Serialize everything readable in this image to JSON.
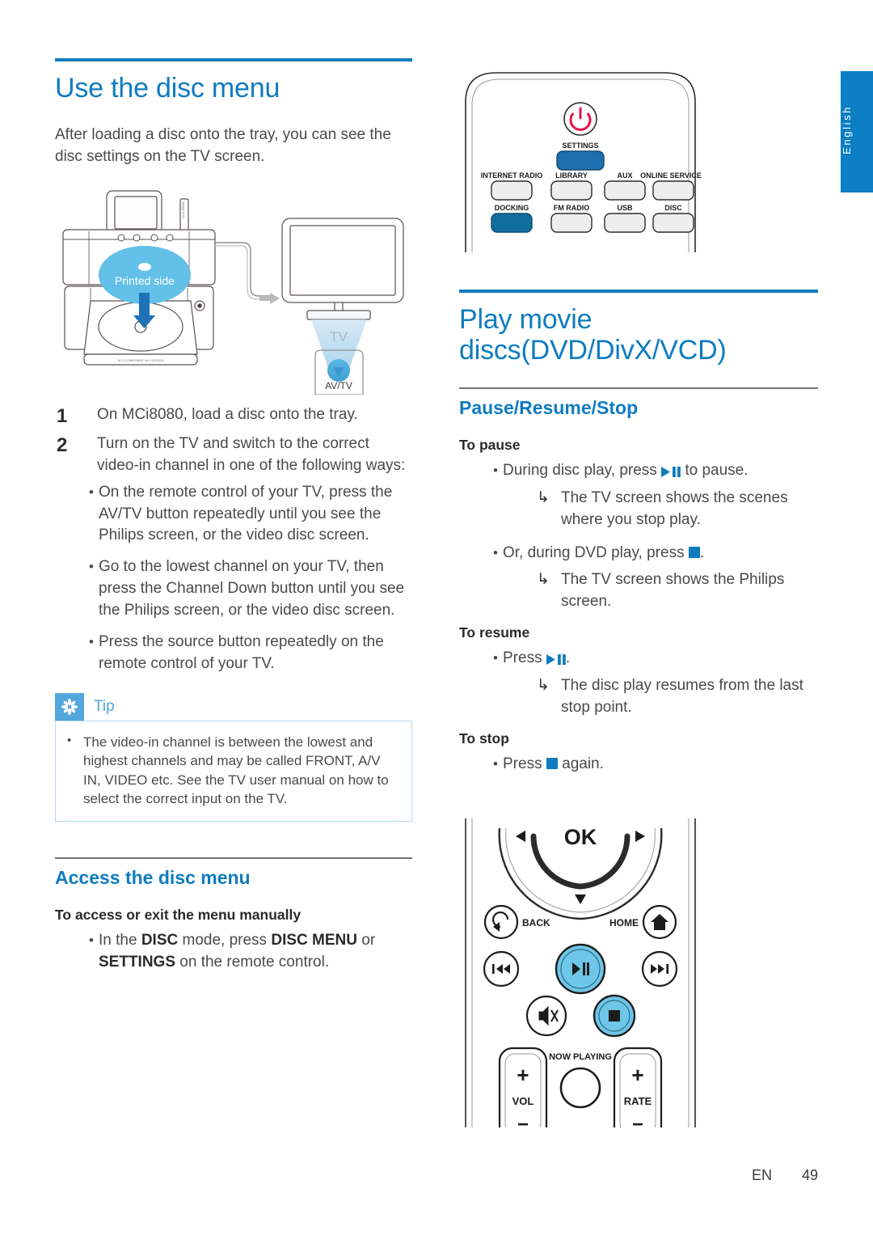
{
  "page": {
    "language_tab": "English",
    "footer_lang": "EN",
    "footer_page": "49"
  },
  "left_column": {
    "title": "Use the disc menu",
    "intro": "After loading a disc onto the tray, you can see the disc settings on the TV screen.",
    "figure_device": {
      "disc_label": "Printed side",
      "tv_label": "TV",
      "avtv_label": "AV/TV",
      "device_badge": "HI-FI COMPONENT Hi-Fi SYSTEM",
      "dock_label": "Up to 500GB"
    },
    "steps": [
      {
        "num": "1",
        "text": "On MCi8080, load a disc onto the tray."
      },
      {
        "num": "2",
        "text": "Turn on the TV and switch to the correct video-in channel in one of the following ways:"
      }
    ],
    "step2_bullets": [
      "On the remote control of your TV, press the AV/TV button repeatedly until you see the Philips screen, or the video disc screen.",
      "Go to the lowest channel on your TV, then press the Channel Down button until you see the Philips screen, or the video disc screen.",
      "Press the source button repeatedly on the remote control of your TV."
    ],
    "tip": {
      "label": "Tip",
      "items": [
        "The video-in channel is between the lowest and highest channels and may be called FRONT, A/V IN, VIDEO etc. See the TV user manual on how to select the correct input on the TV."
      ]
    },
    "access_section": {
      "title": "Access the disc menu",
      "subheading": "To access or exit the menu manually",
      "bullet_parts": [
        "In the ",
        "DISC",
        " mode, press ",
        "DISC MENU",
        " or ",
        "SETTINGS",
        " on the remote control."
      ]
    }
  },
  "right_column": {
    "title": "Play movie discs(DVD/DivX/VCD)",
    "section_title": "Pause/Resume/Stop",
    "groups": [
      {
        "heading": "To pause",
        "bullets": [
          {
            "pre": "During disc play, press ",
            "icon": "play-pause-icon",
            "post": " to pause.",
            "results": [
              "The TV screen shows the scenes where you stop play."
            ]
          },
          {
            "pre": "Or, during DVD play, press ",
            "icon": "stop-icon",
            "post": ".",
            "results": [
              "The TV screen shows the Philips screen."
            ]
          }
        ]
      },
      {
        "heading": "To resume",
        "bullets": [
          {
            "pre": "Press ",
            "icon": "play-pause-icon",
            "post": ".",
            "results": [
              "The disc play resumes from the last stop point."
            ]
          }
        ]
      },
      {
        "heading": "To stop",
        "bullets": [
          {
            "pre": "Press ",
            "icon": "stop-icon",
            "post": " again.",
            "results": []
          }
        ]
      }
    ]
  },
  "remote_top": {
    "power_icon": "power-icon",
    "settings_label": "SETTINGS",
    "buttons_row1": [
      "INTERNET RADIO",
      "LIBRARY",
      "AUX",
      "ONLINE SERVICES"
    ],
    "buttons_row2": [
      "DOCKING",
      "FM RADIO",
      "USB",
      "DISC"
    ],
    "highlight_colors": {
      "settings": "#1d6fb0",
      "docking": "#0f6e9e"
    }
  },
  "remote_bottom": {
    "ok_label": "OK",
    "back_label": "BACK",
    "home_label": "HOME",
    "now_playing_label": "NOW PLAYING",
    "vol_label": "VOL",
    "rate_label": "RATE",
    "plus": "+",
    "minus": "−",
    "icons": [
      "nav-up-icon",
      "nav-left-icon",
      "nav-right-icon",
      "nav-down-icon",
      "back-icon",
      "home-icon",
      "previous-icon",
      "play-pause-icon",
      "next-icon",
      "mute-icon",
      "stop-icon"
    ],
    "highlight_color": "#6ec6e8"
  },
  "colors": {
    "brand_blue": "#0f7cc0",
    "tip_blue": "#53a7dd",
    "light_blue": "#6ec6e8",
    "body_gray": "#4a4a4d"
  }
}
